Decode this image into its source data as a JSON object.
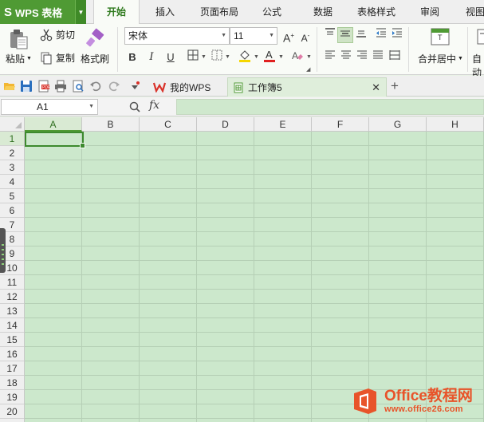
{
  "app": {
    "title": "WPS 表格",
    "logo_glyph": "S"
  },
  "menu": {
    "tabs": [
      {
        "label": "开始",
        "active": true
      },
      {
        "label": "插入"
      },
      {
        "label": "页面布局"
      },
      {
        "label": "公式"
      },
      {
        "label": "数据"
      },
      {
        "label": "表格样式"
      },
      {
        "label": "审阅"
      },
      {
        "label": "视图"
      }
    ]
  },
  "ribbon": {
    "paste_label": "粘贴",
    "cut_label": "剪切",
    "copy_label": "复制",
    "format_painter_label": "格式刷",
    "font_name": "宋体",
    "font_size": "11",
    "bold": "B",
    "italic": "I",
    "underline": "U",
    "merge_center_label": "合并居中",
    "auto_wrap_label": "自动"
  },
  "doc_tabs": {
    "my_wps": "我的WPS",
    "workbook": "工作簿5"
  },
  "formula_bar": {
    "name_box": "A1",
    "fx": "fx",
    "formula": ""
  },
  "grid": {
    "columns": [
      "A",
      "B",
      "C",
      "D",
      "E",
      "F",
      "G",
      "H"
    ],
    "rows": [
      "1",
      "2",
      "3",
      "4",
      "5",
      "6",
      "7",
      "8",
      "9",
      "10",
      "11",
      "12",
      "13",
      "14",
      "15",
      "16",
      "17",
      "18",
      "19",
      "20"
    ],
    "selected_cell": "A1"
  },
  "watermark": {
    "name": "Office教程网",
    "url": "www.office26.com"
  },
  "colors": {
    "brand_green": "#4f9a34",
    "cell_bg": "#cce8cc",
    "watermark": "#e8542a"
  }
}
